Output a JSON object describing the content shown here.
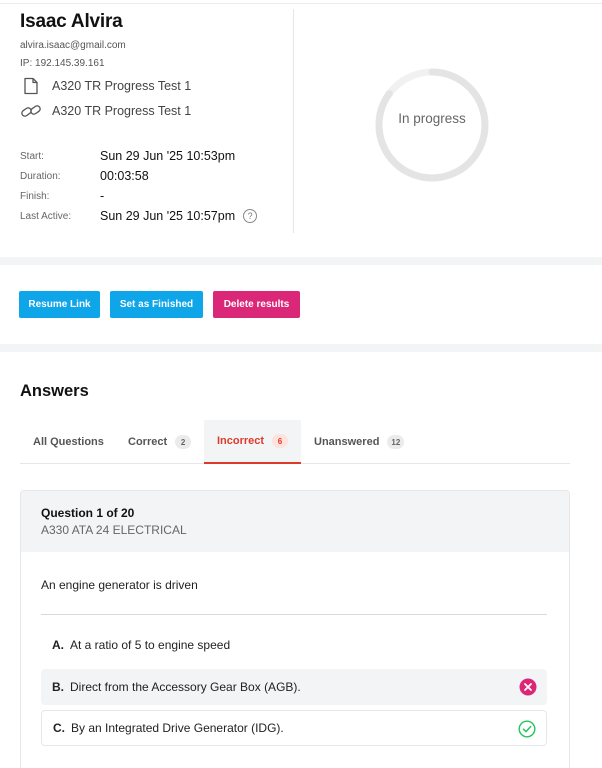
{
  "candidate": {
    "name": "Isaac Alvira",
    "email": "alvira.isaac@gmail.com",
    "ip": "IP: 192.145.39.161"
  },
  "tests": [
    {
      "icon": "document-icon",
      "label": "A320 TR Progress Test 1"
    },
    {
      "icon": "link-icon",
      "label": "A320 TR Progress Test 1"
    }
  ],
  "stats": [
    {
      "label": "Start:",
      "value": "Sun 29 Jun '25 10:53pm"
    },
    {
      "label": "Duration:",
      "value": "00:03:58"
    },
    {
      "label": "Finish:",
      "value": "-"
    },
    {
      "label": "Last Active:",
      "value": "Sun 29 Jun '25 10:57pm"
    }
  ],
  "status": {
    "label": "In progress",
    "progress_fraction": 0.85
  },
  "actions": {
    "resume": "Resume Link",
    "finish": "Set as Finished",
    "delete": "Delete results"
  },
  "answers": {
    "title": "Answers",
    "tabs": [
      {
        "label": "All Questions",
        "count": ""
      },
      {
        "label": "Correct",
        "count": "2"
      },
      {
        "label": "Incorrect",
        "count": "6",
        "active": true
      },
      {
        "label": "Unanswered",
        "count": "12"
      }
    ]
  },
  "question": {
    "number": "Question 1 of 20",
    "category": "A330 ATA 24 ELECTRICAL",
    "text": "An engine generator is driven",
    "options": [
      {
        "letter": "A.",
        "text": "At a ratio of 5 to engine speed",
        "state": "none"
      },
      {
        "letter": "B.",
        "text": "Direct from the Accessory Gear Box (AGB).",
        "state": "selected-incorrect"
      },
      {
        "letter": "C.",
        "text": "By an Integrated Drive Generator (IDG).",
        "state": "correct"
      }
    ]
  },
  "colors": {
    "primary": "#0ea5e9",
    "danger": "#db2777",
    "incorrect": "#dc3b2b",
    "correct": "#22c55e"
  }
}
